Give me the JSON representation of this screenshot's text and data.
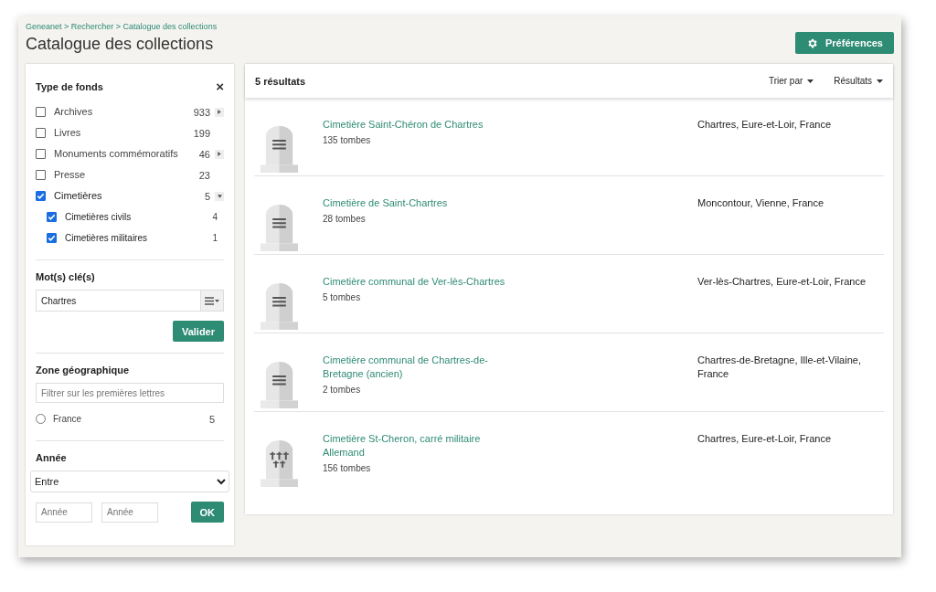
{
  "breadcrumb": "Geneanet > Rechercher > Catalogue des collections",
  "title": "Catalogue des collections",
  "preferences_button": "Préférences",
  "sidebar": {
    "type_de_fonds": {
      "title": "Type de fonds",
      "close": "×",
      "items": [
        {
          "label": "Archives",
          "count": "933",
          "checked": false,
          "kind": "expandable",
          "expanded": false
        },
        {
          "label": "Livres",
          "count": "199",
          "checked": false,
          "kind": "plain"
        },
        {
          "label": "Monuments commémoratifs",
          "count": "46",
          "checked": false,
          "kind": "expandable",
          "expanded": false
        },
        {
          "label": "Presse",
          "count": "23",
          "checked": false,
          "kind": "plain"
        },
        {
          "label": "Cimetières",
          "count": "5",
          "checked": true,
          "kind": "expandable",
          "expanded": true,
          "children": [
            {
              "label": "Cimetières civils",
              "count": "4",
              "checked": true
            },
            {
              "label": "Cimetières militaires",
              "count": "1",
              "checked": true
            }
          ]
        }
      ]
    },
    "keywords": {
      "title": "Mot(s) clé(s)",
      "value": "Chartres",
      "button": "Valider"
    },
    "zone": {
      "title": "Zone géographique",
      "placeholder": "Filtrer sur les premières lettres",
      "options": [
        {
          "label": "France",
          "count": "5",
          "selected": false
        }
      ]
    },
    "year": {
      "title": "Année",
      "mode": "Entre",
      "from_placeholder": "Année",
      "to_placeholder": "Année",
      "button": "OK"
    }
  },
  "results": {
    "count": "5 résultats",
    "sort": "Trier par",
    "display": "Résultats",
    "rows": [
      {
        "name": "Cimetière Saint-Chéron de Chartres",
        "graves": "135 tombes",
        "place": "Chartres, Eure-et-Loir, France",
        "kind": "civil"
      },
      {
        "name": "Cimetière de Saint-Chartres",
        "graves": "28 tombes",
        "place": "Moncontour, Vienne, France",
        "kind": "civil"
      },
      {
        "name": "Cimetière communal de Ver-lès-Chartres",
        "graves": "5 tombes",
        "place": "Ver-lès-Chartres, Eure-et-Loir, France",
        "kind": "civil"
      },
      {
        "name": "Cimetière communal de Chartres-de-Bretagne (ancien)",
        "graves": "2 tombes",
        "place": "Chartres-de-Bretagne, Ille-et-Vilaine, France",
        "kind": "civil"
      },
      {
        "name": "Cimetière St-Cheron, carré militaire Allemand",
        "graves": "156 tombes",
        "place": "Chartres, Eure-et-Loir, France",
        "kind": "military"
      }
    ]
  }
}
